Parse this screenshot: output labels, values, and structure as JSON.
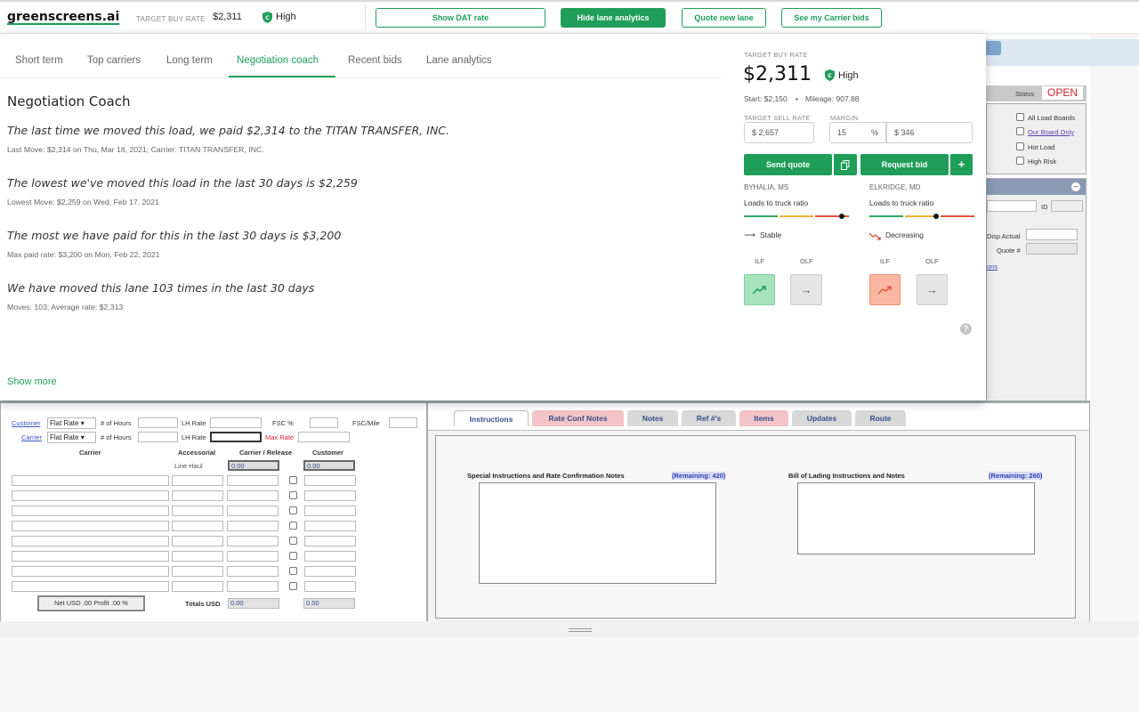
{
  "topbar": {
    "logo": "greenscreens.ai",
    "target_label": "TARGET BUY RATE",
    "target_value": "$2,311",
    "confidence": "High",
    "buttons": [
      "Show DAT rate",
      "Hide lane analytics",
      "Quote new lane",
      "See my Carrier bids"
    ]
  },
  "tabs": [
    "Short term",
    "Top carriers",
    "Long term",
    "Negotiation coach",
    "Recent bids",
    "Lane analytics"
  ],
  "active_tab": "Negotiation coach",
  "coach": {
    "title": "Negotiation Coach",
    "items": [
      {
        "headline": "The last time we moved this load, we paid $2,314 to the TITAN TRANSFER, INC.",
        "detail": "Last Move: $2,314 on Thu, Mar 18, 2021; Carrier: TITAN TRANSFER, INC."
      },
      {
        "headline": "The lowest we've moved this load in the last 30 days is $2,259",
        "detail": "Lowest Move: $2,259 on Wed, Feb 17, 2021"
      },
      {
        "headline": "The most we have paid for this in the last 30 days is $3,200",
        "detail": "Max paid rate: $3,200 on Mon, Feb 22, 2021"
      },
      {
        "headline": "We have moved this lane 103 times in the last 30 days",
        "detail": "Moves: 103; Average rate: $2,313"
      }
    ],
    "show_more": "Show more"
  },
  "rate": {
    "label": "TARGET BUY RATE",
    "value": "$2,311",
    "confidence": "High",
    "start": "Start: $2,150",
    "mileage": "Mileage: 907.88",
    "sell_label": "TARGET SELL RATE",
    "margin_label": "MARGIN",
    "sell_value": "$ 2,657",
    "margin_pct": "15",
    "pct_sign": "%",
    "margin_value": "$ 346",
    "send_quote": "Send quote",
    "request_bid": "Request bid",
    "plus": "+",
    "origin": "BYHALIA, MS",
    "dest": "ELKRIDGE, MD",
    "ltr": "Loads to truck ratio",
    "origin_trend": "Stable",
    "dest_trend": "Decreasing",
    "ilf": "ILF",
    "olf": "OLF",
    "help": "?"
  },
  "legacy": {
    "status_label": "Status",
    "status_value": "OPEN",
    "checks": [
      "All Load Boards",
      "Our Board Only",
      "Hot Load",
      "High Risk"
    ],
    "id_label": "ID",
    "disp_actual": "Disp Actual",
    "quote_no": "Quote #",
    "ons": "ons",
    "fin": {
      "customer": "Customer",
      "carrier": "Carrier",
      "flat_rate": "Flat Rate",
      "hours": "# of Hours",
      "lh_rate": "LH Rate",
      "fsc_pct": "FSC %",
      "fsc_mile": "FSC/Mile",
      "max_rate": "Max Rate",
      "col_carrier": "Carrier",
      "col_accessorial": "Accessorial",
      "col_release": "Carrier / Release",
      "col_customer": "Customer",
      "line_haul": "Line Haul",
      "zero": "0.00",
      "net": "Net USD .00   Profit .00 %",
      "totals": "Totals USD"
    },
    "tabs": [
      "Instructions",
      "Rate Conf Notes",
      "Notes",
      "Ref #'s",
      "Items",
      "Updates",
      "Route"
    ],
    "special": "Special Instructions and Rate Confirmation Notes",
    "special_rem": "(Remaining: 420)",
    "bol": "Bill of Lading Instructions and Notes",
    "bol_rem": "(Remaining: 260)"
  },
  "colors": {
    "brand": "#1f9e5a",
    "status": "#d81f26"
  }
}
